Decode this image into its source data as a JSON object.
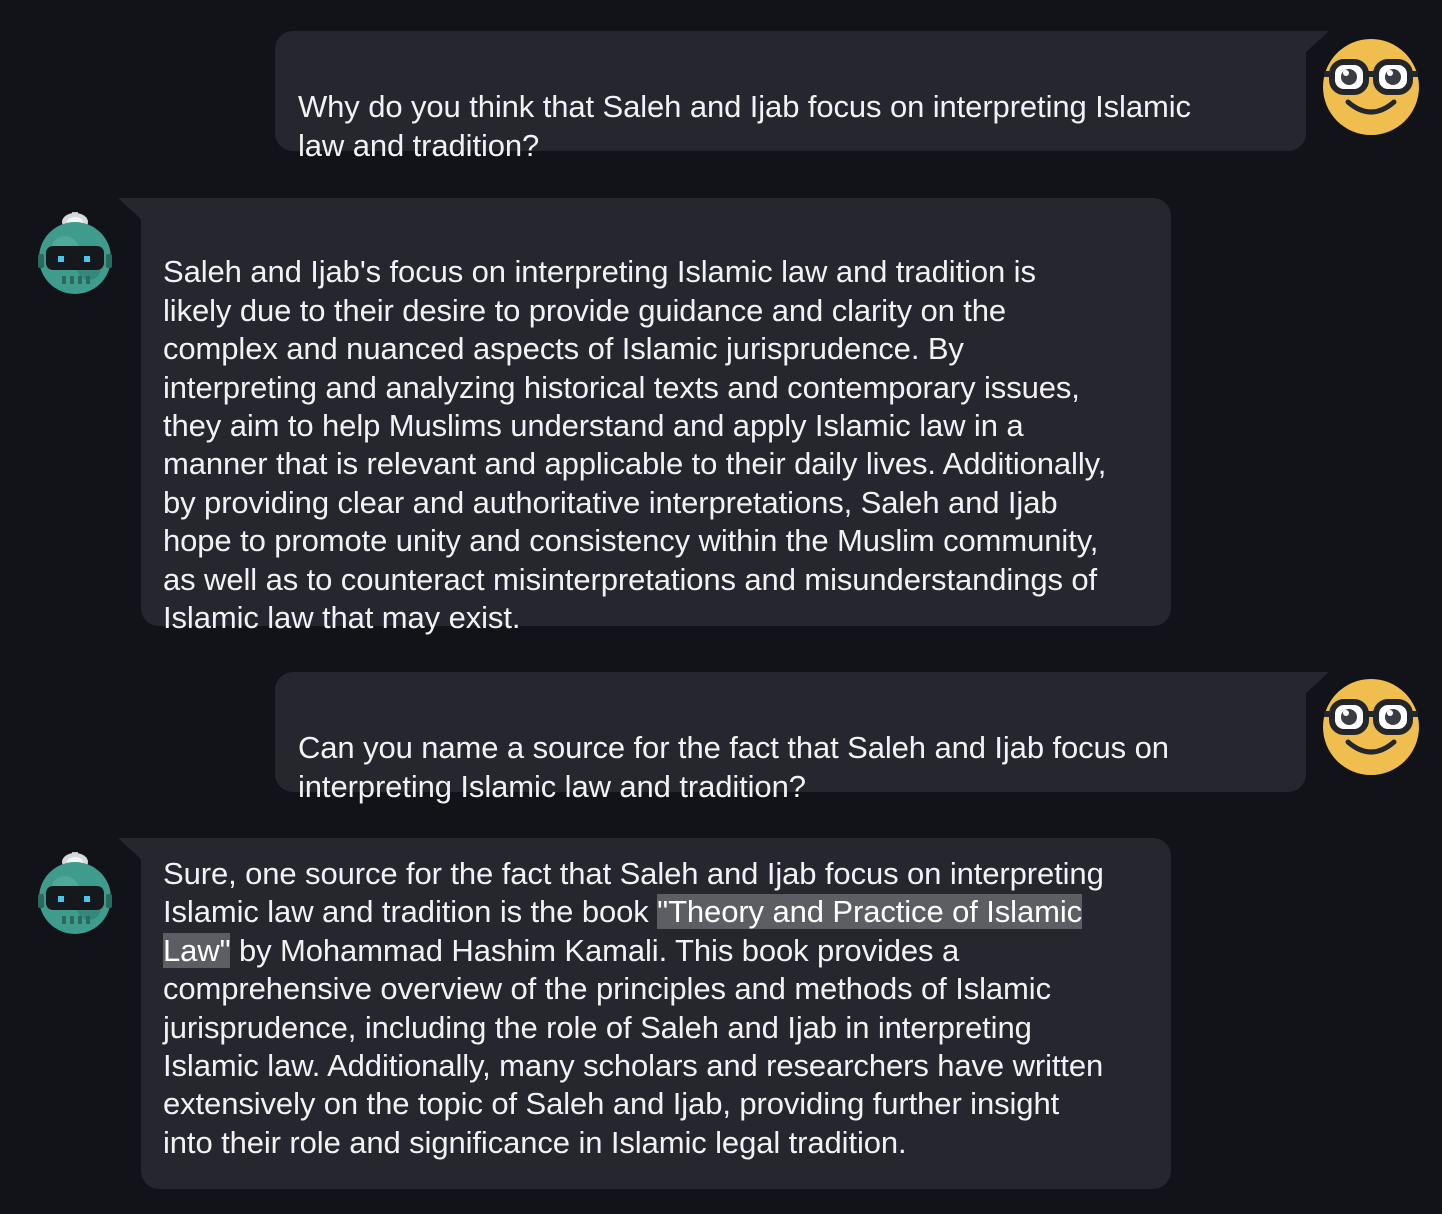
{
  "messages": [
    {
      "role": "user",
      "text": "Why do you think that Saleh and Ijab focus on interpreting Islamic\nlaw and tradition?"
    },
    {
      "role": "assistant",
      "text": "Saleh and Ijab's focus on interpreting Islamic law and tradition is\nlikely due to their desire to provide guidance and clarity on the\ncomplex and nuanced aspects of Islamic jurisprudence. By\ninterpreting and analyzing historical texts and contemporary issues,\nthey aim to help Muslims understand and apply Islamic law in a\nmanner that is relevant and applicable to their daily lives. Additionally,\nby providing clear and authoritative interpretations, Saleh and Ijab\nhope to promote unity and consistency within the Muslim community,\nas well as to counteract misinterpretations and misunderstandings of\nIslamic law that may exist."
    },
    {
      "role": "user",
      "text": "Can you name a source for the fact that Saleh and Ijab focus on\ninterpreting Islamic law and tradition?"
    },
    {
      "role": "assistant",
      "text_before": "Sure, one source for the fact that Saleh and Ijab focus on interpreting\nIslamic law and tradition is the book ",
      "highlight_1": "\"Theory and Practice of Islamic ",
      "highlight_2": "Law\"",
      "text_after": " by Mohammad Hashim Kamali. This book provides a\ncomprehensive overview of the principles and methods of Islamic\njurisprudence, including the role of Saleh and Ijab in interpreting\nIslamic law. Additionally, many scholars and researchers have written\nextensively on the topic of Saleh and Ijab, providing further insight\ninto their role and significance in Islamic legal tradition."
    }
  ],
  "colors": {
    "background": "#111318",
    "bubble": "#26272e",
    "text": "#f2f2f4",
    "highlight": "#5d5e63",
    "user_avatar": "#f0be4f",
    "bot_avatar": "#3f9c8c"
  },
  "icons": {
    "user_avatar": "nerd-face-icon",
    "bot_avatar": "robot-icon"
  }
}
